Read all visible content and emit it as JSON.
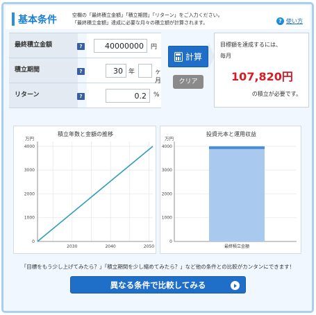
{
  "header": {
    "title": "基本条件",
    "desc_line1": "空欄の「最終積立金額」「積立期間」「リターン」をご入力ください。",
    "desc_line2": "「最終積立金額」達成に必要な月々の積立額が計算されます。",
    "help_label": "使い方",
    "help_icon": "?"
  },
  "form": {
    "target_label": "最終積立金額",
    "target_value": "40000000",
    "target_unit": "円",
    "period_label": "積立期間",
    "period_years": "30",
    "years_unit": "年",
    "period_months": "",
    "months_unit": "ヶ月",
    "return_label": "リターン",
    "return_value": "0.2",
    "return_unit": "%",
    "tip_glyph": "?"
  },
  "buttons": {
    "calc_label": "計算",
    "clear_label": "クリア",
    "compare_label": "異なる条件で比較してみる"
  },
  "result": {
    "line1": "目標額を達成するには、",
    "line2": "毎月",
    "amount": "107,820円",
    "line3": "の積立が必要です。"
  },
  "notice": "「目標をもう少し上げてみたら？」「積立期間を少し縮めてみたら？」など他の条件との比較がカンタンにできます！",
  "colors": {
    "accent": "#1f6fc9",
    "line": "#2e9cb8",
    "bar": "#a9c9ef",
    "amount": "#d71c26"
  },
  "chart_data": [
    {
      "type": "line",
      "title": "積立年数と金額の推移",
      "ylabel": "万円",
      "xlabel": "",
      "x_ticks": [
        2030,
        2040,
        2050
      ],
      "y_ticks": [
        0,
        1000,
        2000,
        3000,
        4000
      ],
      "xlim": [
        2021,
        2051
      ],
      "ylim": [
        0,
        4200
      ],
      "series": [
        {
          "x": [
            2021,
            2051
          ],
          "values": [
            0,
            4000
          ]
        }
      ]
    },
    {
      "type": "bar",
      "title": "投資元本と運用収益",
      "ylabel": "万円",
      "categories": [
        "最終積立金額"
      ],
      "y_ticks": [
        0,
        1000,
        2000,
        3000,
        4000
      ],
      "ylim": [
        0,
        4200
      ],
      "series": [
        {
          "values": [
            3882
          ]
        },
        {
          "values": [
            118
          ]
        }
      ]
    }
  ]
}
